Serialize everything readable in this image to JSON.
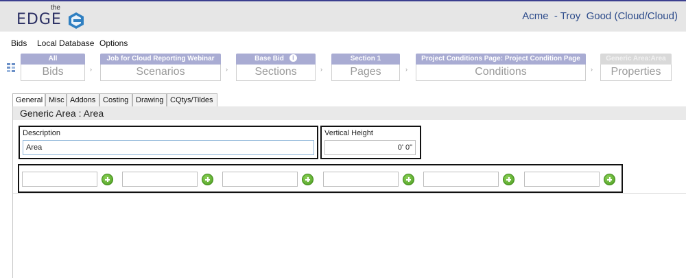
{
  "header": {
    "logo_small": "the",
    "logo_text": "EDGE",
    "user_info": "Acme  - Troy  Good (Cloud/Cloud)"
  },
  "menu": [
    "Bids",
    "Local Database",
    "Options"
  ],
  "breadcrumb": [
    {
      "top": "All",
      "bottom": "Bids",
      "disabled": false
    },
    {
      "top": "Job for Cloud Reporting Webinar",
      "bottom": "Scenarios",
      "disabled": false
    },
    {
      "top": "Base Bid",
      "bottom": "Sections",
      "disabled": false
    },
    {
      "top": "Section 1",
      "bottom": "Pages",
      "disabled": false
    },
    {
      "top": "Project Conditions Page: Project Condition Page",
      "bottom": "Conditions",
      "disabled": false
    },
    {
      "top": "Generic Area:Area",
      "bottom": "Properties",
      "disabled": true
    }
  ],
  "tabs": [
    "General",
    "Misc",
    "Addons",
    "Costing",
    "Drawing",
    "CQtys/Tildes"
  ],
  "active_tab": "General",
  "panel_title": "Generic Area : Area",
  "description": {
    "label": "Description",
    "value": "Area"
  },
  "vertical_height": {
    "label": "Vertical Height",
    "value": "0' 0\""
  },
  "addon_fields": [
    "",
    "",
    "",
    "",
    "",
    ""
  ],
  "colors": {
    "header_bg": "#e6e6e6",
    "accent": "#a9acd3",
    "user_text": "#2b4a8a",
    "add_green": "#4a9a1f"
  }
}
